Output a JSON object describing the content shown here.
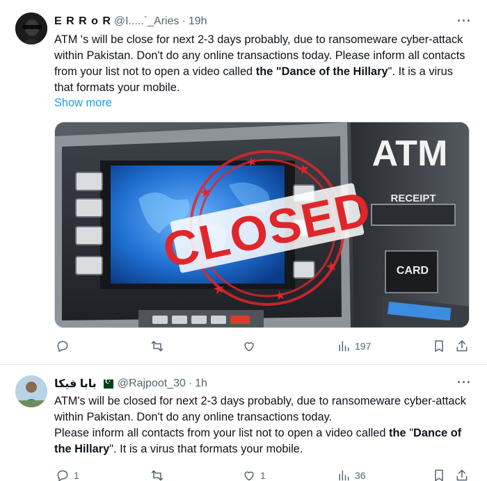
{
  "tweets": [
    {
      "name": "E R R o R",
      "handle": "@I.....`_Aries",
      "time": "19h",
      "text_parts": [
        "ATM 's will be close for next 2-3 days probably, due to ransomeware cyber-attack within Pakistan. Don't do any online transactions today. Please inform all contacts from your list not to open a video called ",
        "the \"Dance of the Hillary",
        "\". It is a virus that formats your mobile."
      ],
      "show_more": "Show more",
      "image": {
        "atm_sign": "ATM",
        "receipt_label": "RECEIPT",
        "card_label": "CARD",
        "stamp_text": "CLOSED"
      },
      "actions": {
        "reply": "",
        "retweet": "",
        "like": "",
        "views": "197"
      }
    },
    {
      "name": "بابا فیکا",
      "handle": "@Rajpoot_30",
      "time": "1h",
      "text_parts": [
        "ATM's will be closed for next 2-3 days probably, due to ransomeware cyber-attack within Pakistan. Don't do any online transactions today.",
        "Please inform all contacts from your list not to open a video called ",
        "the",
        "\"",
        "Dance of the Hillary",
        "\". It is a virus that formats your mobile."
      ],
      "actions": {
        "reply": "1",
        "retweet": "",
        "like": "1",
        "views": "36"
      }
    }
  ],
  "colors": {
    "link": "#1d9bf0",
    "secondary_text": "#536471",
    "stamp_red": "#e0262b",
    "screen_blue": "#1f6fd1"
  },
  "icons": [
    "more-icon",
    "reply-icon",
    "retweet-icon",
    "like-icon",
    "views-icon",
    "bookmark-icon",
    "share-icon",
    "pakistan-flag-icon"
  ]
}
